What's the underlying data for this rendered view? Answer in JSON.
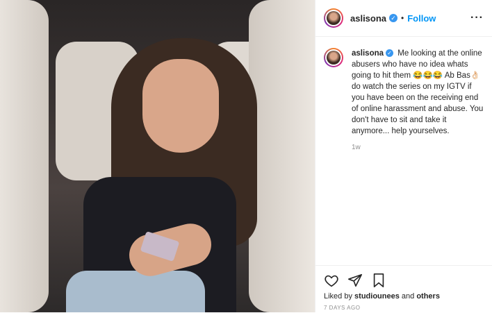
{
  "post": {
    "username": "aslisona",
    "follow_label": "Follow",
    "verified_icon": "✓",
    "caption": "Me looking at the online abusers who have no idea whats going to hit them 😂😂😂 Ab Bas👌🏻 do watch the series on my IGTV if you have been on the receiving end of online harassment and abuse. You don't have to sit and take it anymore... help yourselves.",
    "time_ago": "1w",
    "liked_by_prefix": "Liked by",
    "liked_by_user": "studiounees",
    "liked_by_and": "and",
    "liked_by_others": "others",
    "date": "7 DAYS AGO"
  },
  "colors": {
    "link": "#0095f6",
    "verified": "#3897f0",
    "muted": "#8e8e8e",
    "text": "#262626"
  },
  "icons": [
    "heart-icon",
    "share-icon",
    "bookmark-icon",
    "more-options-icon",
    "verified-badge-icon"
  ]
}
